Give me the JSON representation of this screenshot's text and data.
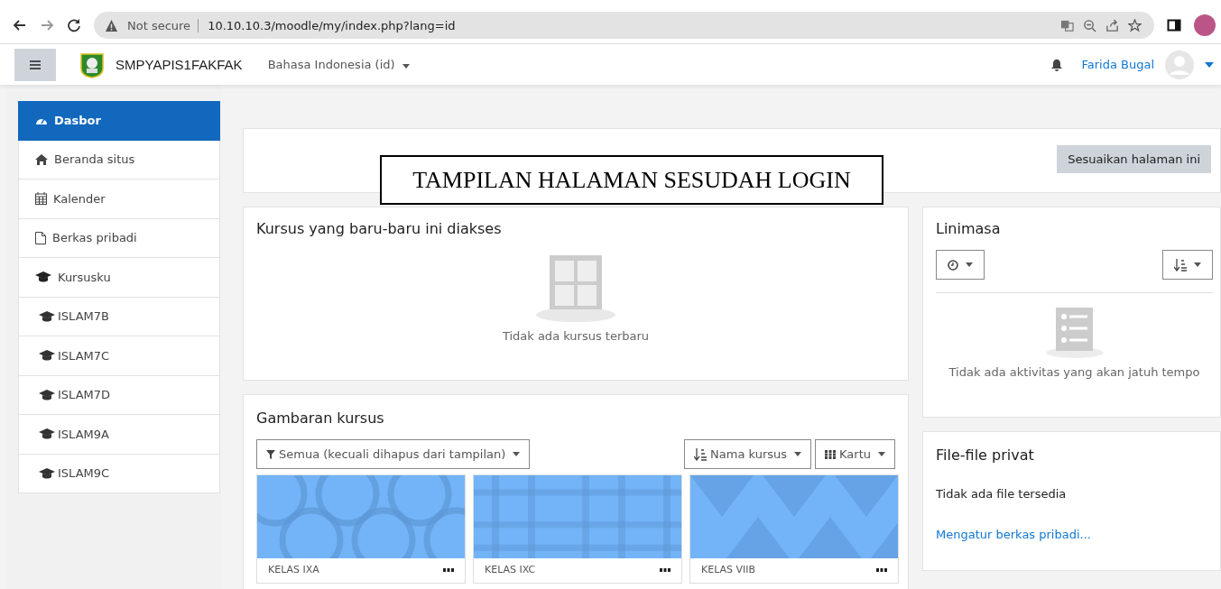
{
  "browser": {
    "security": "Not secure",
    "url": "10.10.10.3/moodle/my/index.php?lang=id"
  },
  "navbar": {
    "site_name": "SMPYAPIS1FAKFAK",
    "language": "Bahasa Indonesia (id)",
    "user_name": "Farida Bugal"
  },
  "sidebar": {
    "items": [
      {
        "label": "Dasbor",
        "selected": true
      },
      {
        "label": "Beranda situs",
        "selected": false
      },
      {
        "label": "Kalender",
        "selected": false
      },
      {
        "label": "Berkas pribadi",
        "selected": false
      },
      {
        "label": "Kursusku",
        "selected": false,
        "children": [
          {
            "label": "ISLAM7B",
            "selected": false
          },
          {
            "label": "ISLAM7C",
            "selected": false
          },
          {
            "label": "ISLAM7D",
            "selected": false
          },
          {
            "label": "ISLAM9A",
            "selected": false
          },
          {
            "label": "ISLAM9C",
            "selected": false
          }
        ]
      }
    ]
  },
  "customize_button": "Sesuaikan halaman ini",
  "caption": "TAMPILAN HALAMAN SESUDAH LOGIN",
  "recent_courses": {
    "title": "Kursus yang baru-baru ini diakses",
    "empty_text": "Tidak ada kursus terbaru"
  },
  "course_overview": {
    "title": "Gambaran kursus",
    "filter": "Semua (kecuali dihapus dari tampilan)",
    "sort": "Nama kursus",
    "view": "Kartu",
    "courses": [
      {
        "name": "KELAS IXA"
      },
      {
        "name": "KELAS IXC"
      },
      {
        "name": "KELAS VIIB"
      }
    ]
  },
  "timeline": {
    "title": "Linimasa",
    "empty_text": "Tidak ada aktivitas yang akan jatuh tempo"
  },
  "private_files": {
    "title": "File-file privat",
    "empty_text": "Tidak ada file tersedia",
    "link": "Mengatur berkas pribadi..."
  }
}
